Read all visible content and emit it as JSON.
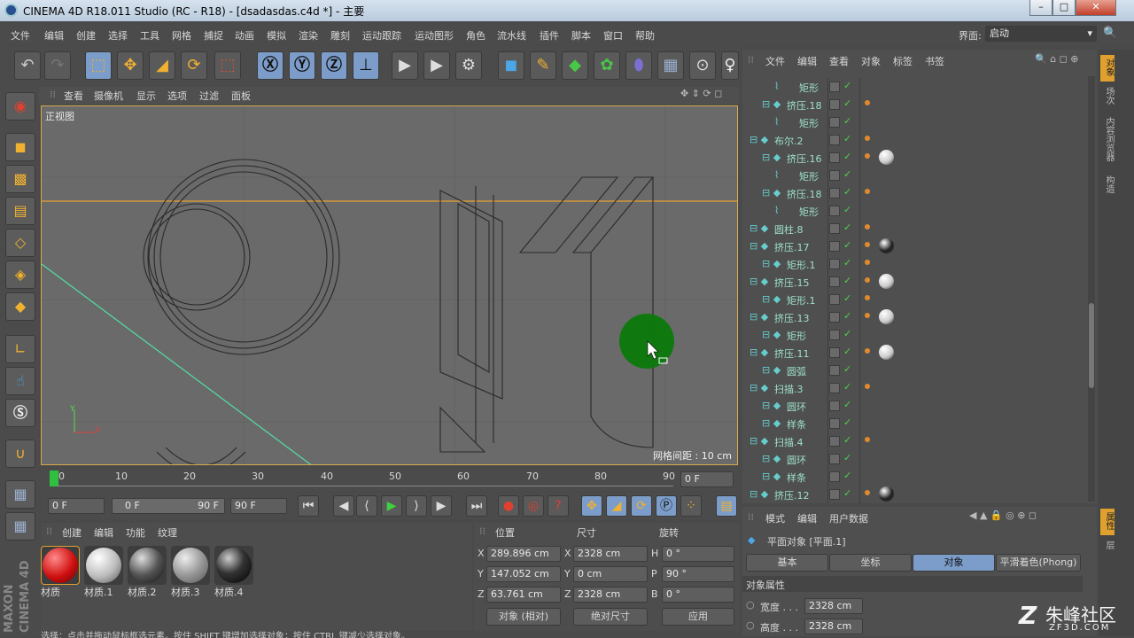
{
  "window": {
    "title": "CINEMA 4D R18.011 Studio (RC - R18) - [dsadasdas.c4d *] - 主要",
    "btn_min": "–",
    "btn_max": "□",
    "btn_close": "✕"
  },
  "menubar": {
    "items": [
      "文件",
      "编辑",
      "创建",
      "选择",
      "工具",
      "网格",
      "捕捉",
      "动画",
      "模拟",
      "渲染",
      "雕刻",
      "运动跟踪",
      "运动图形",
      "角色",
      "流水线",
      "插件",
      "脚本",
      "窗口",
      "帮助"
    ],
    "layout_label": "界面:",
    "layout_value": "启动"
  },
  "viewport": {
    "menu": [
      "查看",
      "摄像机",
      "显示",
      "选项",
      "过滤",
      "面板"
    ],
    "view_name": "正视图",
    "grid_info": "网格间距 : 10 cm",
    "axis_x": "X",
    "axis_y": "Y"
  },
  "timeline": {
    "ticks": [
      "0",
      "10",
      "20",
      "30",
      "40",
      "50",
      "60",
      "70",
      "80",
      "90"
    ],
    "current": "0 F"
  },
  "playback": {
    "start": "0 F",
    "range_start": "0 F",
    "range_end": "90 F",
    "end": "90 F"
  },
  "material_panel": {
    "menu": [
      "创建",
      "编辑",
      "功能",
      "纹理"
    ],
    "materials": [
      "材质",
      "材质.1",
      "材质.2",
      "材质.3",
      "材质.4"
    ]
  },
  "coord_panel": {
    "headers": [
      "位置",
      "尺寸",
      "旋转"
    ],
    "rows": [
      {
        "a": "X",
        "pos": "289.896 cm",
        "b": "X",
        "size": "2328 cm",
        "c": "H",
        "rot": "0 °"
      },
      {
        "a": "Y",
        "pos": "147.052 cm",
        "b": "Y",
        "size": "0 cm",
        "c": "P",
        "rot": "90 °"
      },
      {
        "a": "Z",
        "pos": "63.761 cm",
        "b": "Z",
        "size": "2328 cm",
        "c": "B",
        "rot": "0 °"
      }
    ],
    "mode1": "对象 (相对)",
    "mode2": "绝对尺寸",
    "apply": "应用"
  },
  "object_panel": {
    "menu": [
      "文件",
      "编辑",
      "查看",
      "对象",
      "标签",
      "书签"
    ],
    "objects": [
      {
        "name": "矩形",
        "indent": 2
      },
      {
        "name": "挤压.18",
        "indent": 1
      },
      {
        "name": "矩形",
        "indent": 2
      },
      {
        "name": "布尔.2",
        "indent": 0
      },
      {
        "name": "挤压.16",
        "indent": 1
      },
      {
        "name": "矩形",
        "indent": 2
      },
      {
        "name": "挤压.18",
        "indent": 1
      },
      {
        "name": "矩形",
        "indent": 2
      },
      {
        "name": "圆柱.8",
        "indent": 0
      },
      {
        "name": "挤压.17",
        "indent": 0
      },
      {
        "name": "矩形.1",
        "indent": 1
      },
      {
        "name": "挤压.15",
        "indent": 0
      },
      {
        "name": "矩形.1",
        "indent": 1
      },
      {
        "name": "挤压.13",
        "indent": 0
      },
      {
        "name": "矩形",
        "indent": 1
      },
      {
        "name": "挤压.11",
        "indent": 0
      },
      {
        "name": "圆弧",
        "indent": 1
      },
      {
        "name": "扫描.3",
        "indent": 0
      },
      {
        "name": "圆环",
        "indent": 1
      },
      {
        "name": "样条",
        "indent": 1
      },
      {
        "name": "扫描.4",
        "indent": 0
      },
      {
        "name": "圆环",
        "indent": 1
      },
      {
        "name": "样条",
        "indent": 1
      },
      {
        "name": "挤压.12",
        "indent": 0
      }
    ]
  },
  "attr_panel": {
    "menu": [
      "模式",
      "编辑",
      "用户数据"
    ],
    "object": "平面对象 [平面.1]",
    "tabs": [
      "基本",
      "坐标",
      "对象",
      "平滑着色(Phong)"
    ],
    "section": "对象属性",
    "width_label": "宽度 . . .",
    "width": "2328 cm",
    "height_label": "高度 . . .",
    "height": "2328 cm"
  },
  "right_tabs": [
    "对象",
    "场次",
    "内容浏览器",
    "构造"
  ],
  "right_tabs2": [
    "属性",
    "层"
  ],
  "status": "选择：点击并拖动鼠标框选元素。按住 SHIFT 键增加选择对象；按住 CTRL 键减少选择对象。",
  "watermark": {
    "brand": "朱峰社区",
    "url": "ZF3D.COM"
  },
  "maxon": "MAXON CINEMA 4D"
}
